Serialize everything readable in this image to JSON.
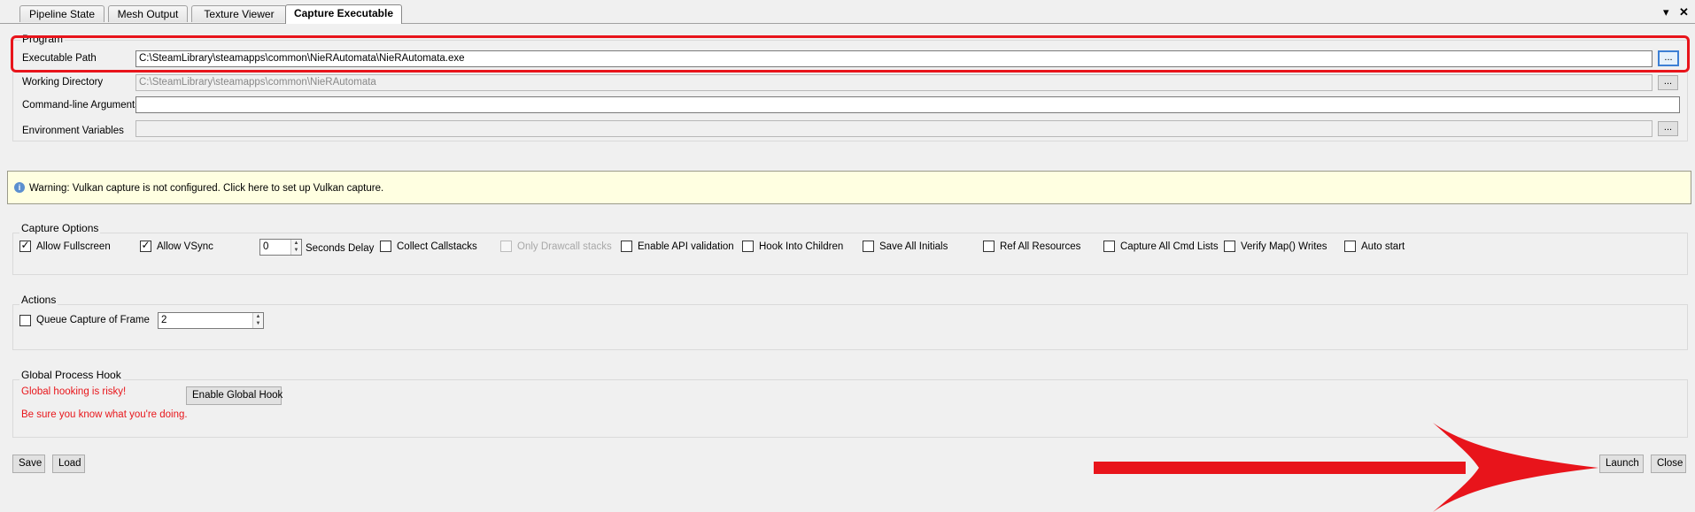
{
  "tabs": [
    {
      "label": "Pipeline State"
    },
    {
      "label": "Mesh Output"
    },
    {
      "label": "Texture Viewer"
    },
    {
      "label": "Capture Executable"
    }
  ],
  "tab_controls": {
    "dropdown": "▾",
    "close": "✕"
  },
  "program": {
    "title": "Program",
    "exe_label": "Executable Path",
    "exe_value": "C:\\SteamLibrary\\steamapps\\common\\NieRAutomata\\NieRAutomata.exe",
    "workdir_label": "Working Directory",
    "workdir_value": "C:\\SteamLibrary\\steamapps\\common\\NieRAutomata",
    "args_label": "Command-line Arguments",
    "args_value": "",
    "env_label": "Environment Variables",
    "env_value": "",
    "browse": "..."
  },
  "warning": {
    "icon": "i",
    "text": "Warning: Vulkan capture is not configured. Click here to set up Vulkan capture."
  },
  "capture_options": {
    "title": "Capture Options",
    "allow_fullscreen": "Allow Fullscreen",
    "allow_vsync": "Allow VSync",
    "delay_value": "0",
    "delay_label": "Seconds Delay",
    "collect_callstacks": "Collect Callstacks",
    "only_drawcall": "Only Drawcall stacks",
    "enable_api_validation": "Enable API validation",
    "hook_children": "Hook Into Children",
    "save_initials": "Save All Initials",
    "ref_resources": "Ref All Resources",
    "capture_cmd_lists": "Capture All Cmd Lists",
    "verify_map": "Verify Map() Writes",
    "auto_start": "Auto start"
  },
  "actions": {
    "title": "Actions",
    "queue_label": "Queue Capture of Frame",
    "queue_value": "2"
  },
  "global_hook": {
    "title": "Global Process Hook",
    "risky": "Global hooking is risky!",
    "sure": "Be sure you know what you're doing.",
    "button": "Enable Global Hook"
  },
  "buttons": {
    "save": "Save",
    "load": "Load",
    "launch": "Launch",
    "close": "Close"
  },
  "colors": {
    "annotation_red": "#e8141b",
    "warning_bg": "#ffffe1",
    "warning_text_red": "#e8161b"
  }
}
